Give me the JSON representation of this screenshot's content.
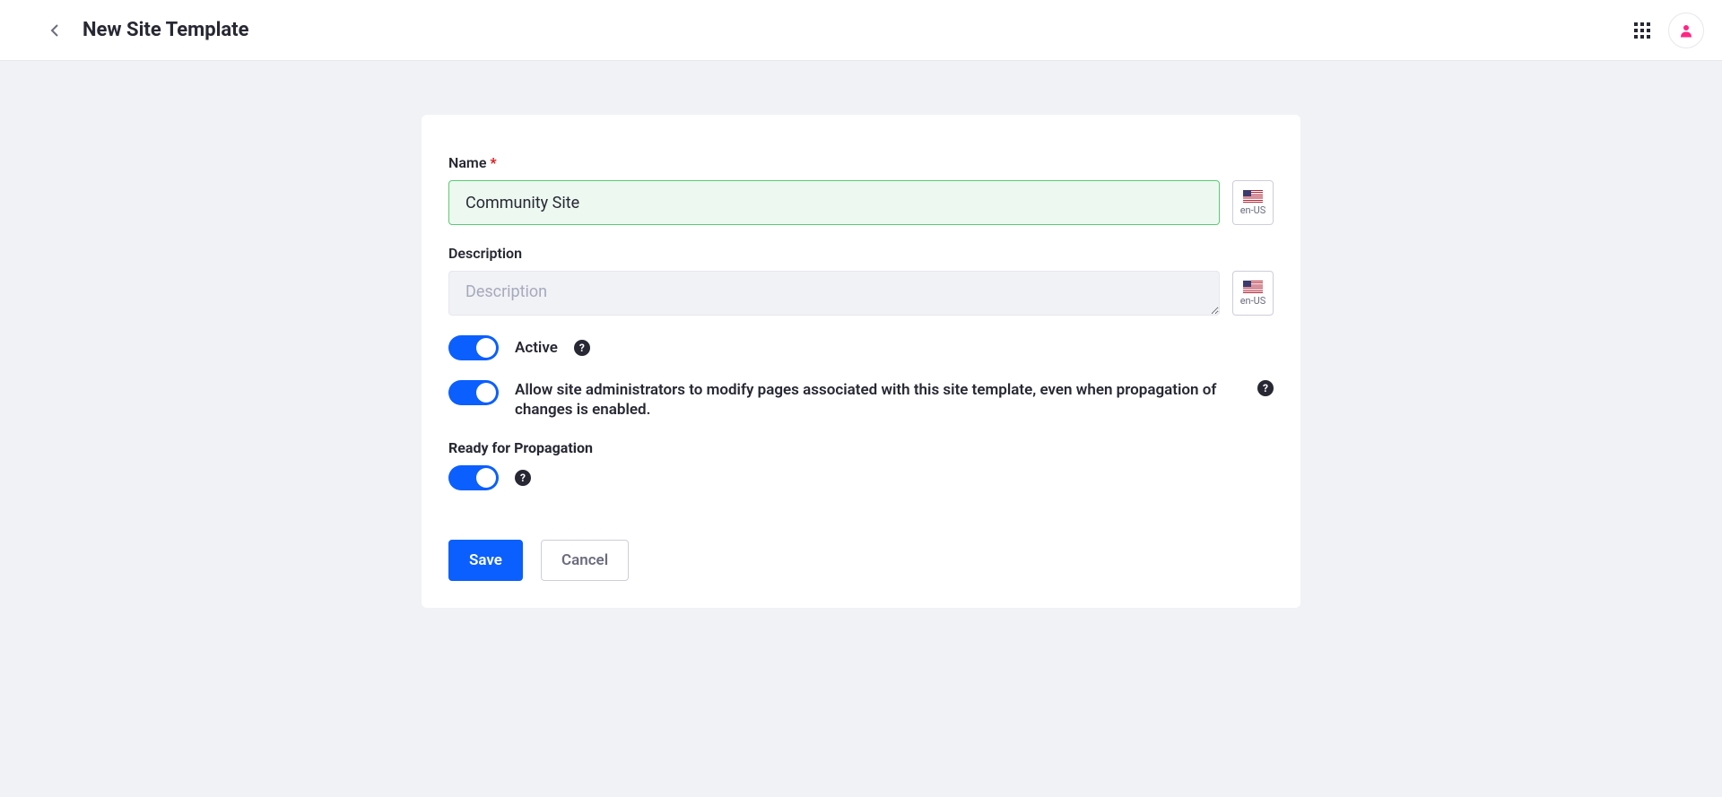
{
  "header": {
    "title": "New Site Template"
  },
  "form": {
    "name": {
      "label": "Name",
      "required_marker": "*",
      "value": "Community Site",
      "locale": "en-US"
    },
    "description": {
      "label": "Description",
      "placeholder": "Description",
      "value": "",
      "locale": "en-US"
    },
    "active": {
      "label": "Active",
      "value": true
    },
    "allow_modify": {
      "label": "Allow site administrators to modify pages associated with this site template, even when propagation of changes is enabled.",
      "value": true
    },
    "propagation": {
      "section_label": "Ready for Propagation",
      "value": true
    }
  },
  "actions": {
    "save": "Save",
    "cancel": "Cancel"
  },
  "help_glyph": "?"
}
